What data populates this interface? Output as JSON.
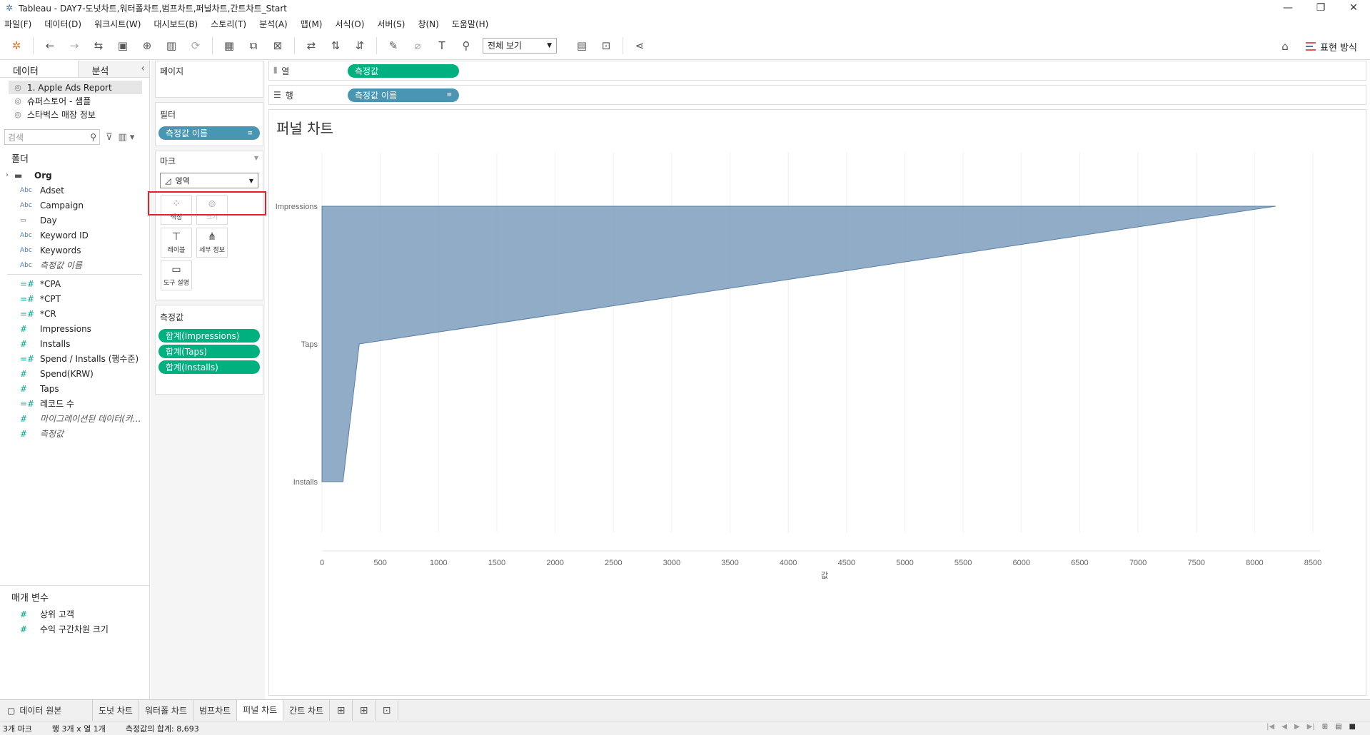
{
  "window": {
    "title": "Tableau - DAY7-도넛차트,워터폴차트,범프차트,퍼널차트,간트차트_Start"
  },
  "menu": [
    "파일(F)",
    "데이터(D)",
    "워크시트(W)",
    "대시보드(B)",
    "스토리(T)",
    "분석(A)",
    "맵(M)",
    "서식(O)",
    "서버(S)",
    "창(N)",
    "도움말(H)"
  ],
  "toolbar": {
    "view_select": "전체 보기",
    "show_me": "표현 방식"
  },
  "data_pane": {
    "tab_data": "데이터",
    "tab_analytics": "분석",
    "datasources": [
      "1. Apple Ads Report",
      "슈퍼스토어 - 샘플",
      "스타벅스 매장 정보"
    ],
    "search_placeholder": "검색",
    "folders_title": "폴더",
    "folder_org": "Org",
    "dimensions": [
      {
        "type": "Abc",
        "name": "Adset"
      },
      {
        "type": "Abc",
        "name": "Campaign"
      },
      {
        "type": "▭",
        "name": "Day"
      },
      {
        "type": "Abc",
        "name": "Keyword ID"
      },
      {
        "type": "Abc",
        "name": "Keywords"
      },
      {
        "type": "Abc",
        "name": "측정값 이름"
      }
    ],
    "measures": [
      {
        "type": "=#",
        "name": "*CPA"
      },
      {
        "type": "=#",
        "name": "*CPT"
      },
      {
        "type": "=#",
        "name": "*CR"
      },
      {
        "type": "#",
        "name": "Impressions"
      },
      {
        "type": "#",
        "name": "Installs"
      },
      {
        "type": "=#",
        "name": "Spend / Installs (행수준)"
      },
      {
        "type": "#",
        "name": "Spend(KRW)"
      },
      {
        "type": "#",
        "name": "Taps"
      },
      {
        "type": "=#",
        "name": "레코드 수"
      },
      {
        "type": "#",
        "name": "마이그레이션된 데이터(카..."
      },
      {
        "type": "#",
        "name": "측정값"
      }
    ],
    "params_title": "매개 변수",
    "params": [
      {
        "type": "#",
        "name": "상위 고객"
      },
      {
        "type": "#",
        "name": "수익 구간차원 크기"
      }
    ]
  },
  "cards": {
    "pages_title": "페이지",
    "filters_title": "필터",
    "filter_pill": "측정값 이름",
    "marks_title": "마크",
    "mark_type": "영역",
    "mark_buttons": {
      "color": "색상",
      "size": "크기",
      "label": "레이블",
      "detail": "세부 정보",
      "tooltip": "도구 설명"
    },
    "measure_values_title": "측정값",
    "measure_values": [
      "합계(Impressions)",
      "합계(Taps)",
      "합계(Installs)"
    ]
  },
  "shelves": {
    "columns_label": "열",
    "columns_pill": "측정값",
    "rows_label": "행",
    "rows_pill": "측정값 이름"
  },
  "viz": {
    "title": "퍼널 차트"
  },
  "chart_data": {
    "type": "area",
    "title": "퍼널 차트",
    "xlabel": "값",
    "ylabel": "",
    "categories": [
      "Impressions",
      "Taps",
      "Installs"
    ],
    "values": [
      8180,
      320,
      180
    ],
    "xlim": [
      0,
      8500
    ],
    "x_ticks": [
      0,
      500,
      1000,
      1500,
      2000,
      2500,
      3000,
      3500,
      4000,
      4500,
      5000,
      5500,
      6000,
      6500,
      7000,
      7500,
      8000,
      8500
    ],
    "grid": "vertical",
    "color": "#7d9dbd"
  },
  "sheets": {
    "datasource_tab": "데이터 원본",
    "tabs": [
      "도넛 차트",
      "워터폴 차트",
      "범프차트",
      "퍼널 차트",
      "간트 차트"
    ],
    "active_tab": "퍼널 차트"
  },
  "status": {
    "marks": "3개 마크",
    "rows_cols": "행 3개 x 열 1개",
    "sum": "측정값의 합계: 8,693"
  }
}
